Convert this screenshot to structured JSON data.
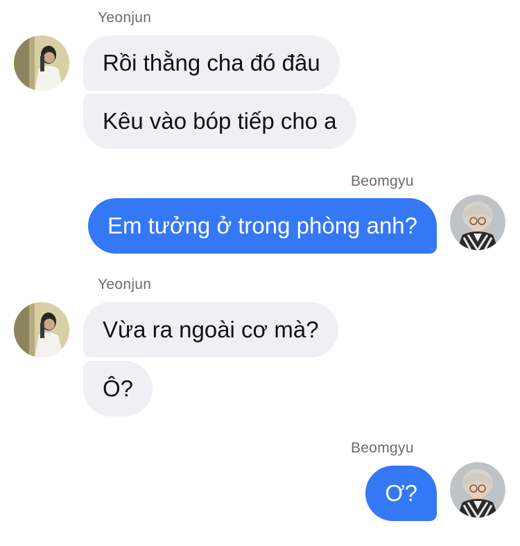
{
  "colors": {
    "incoming_bubble": "#f0f0f4",
    "outgoing_bubble": "#3478f6",
    "sender_name": "#6b6b70"
  },
  "messages": [
    {
      "sender": "Yeonjun",
      "direction": "incoming",
      "avatar": "yeonjun-avatar",
      "texts": [
        "Rồi thằng cha đó đâu",
        "Kêu vào bóp tiếp cho a"
      ]
    },
    {
      "sender": "Beomgyu",
      "direction": "outgoing",
      "avatar": "beomgyu-avatar",
      "texts": [
        "Em tưởng ở trong phòng anh?"
      ]
    },
    {
      "sender": "Yeonjun",
      "direction": "incoming",
      "avatar": "yeonjun-avatar",
      "texts": [
        "Vừa ra ngoài cơ mà?",
        "Ô?"
      ]
    },
    {
      "sender": "Beomgyu",
      "direction": "outgoing",
      "avatar": "beomgyu-avatar",
      "texts": [
        "Ơ?"
      ]
    }
  ]
}
